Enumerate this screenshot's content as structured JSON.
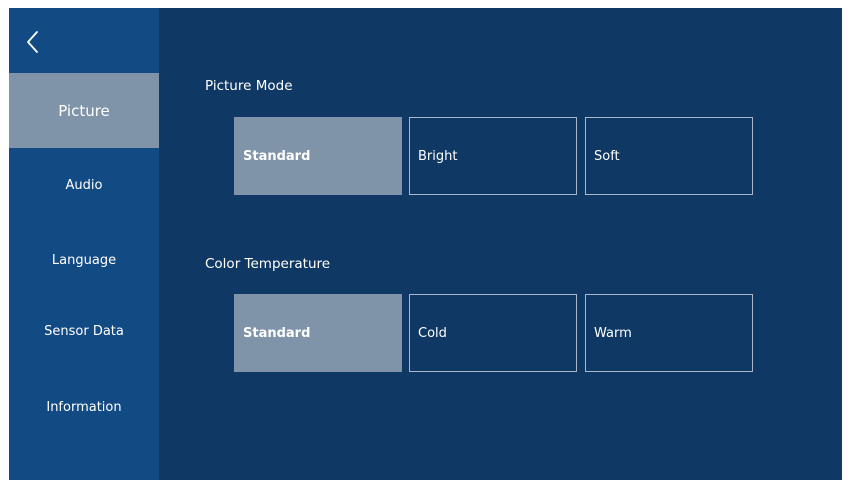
{
  "colors": {
    "background": "#0f3864",
    "sidebar": "#124a84",
    "selected": "#7f93a9",
    "text": "#ffffff",
    "border": "#a9b7c8"
  },
  "back_icon": "chevron-left-icon",
  "sidebar": {
    "items": [
      {
        "label": "Picture",
        "active": true
      },
      {
        "label": "Audio",
        "active": false
      },
      {
        "label": "Language",
        "active": false
      },
      {
        "label": "Sensor Data",
        "active": false
      },
      {
        "label": "Information",
        "active": false
      }
    ]
  },
  "picture_mode": {
    "label": "Picture Mode",
    "options": [
      "Standard",
      "Bright",
      "Soft"
    ],
    "selected": "Standard"
  },
  "color_temperature": {
    "label": "Color Temperature",
    "options": [
      "Standard",
      "Cold",
      "Warm"
    ],
    "selected": "Standard"
  }
}
